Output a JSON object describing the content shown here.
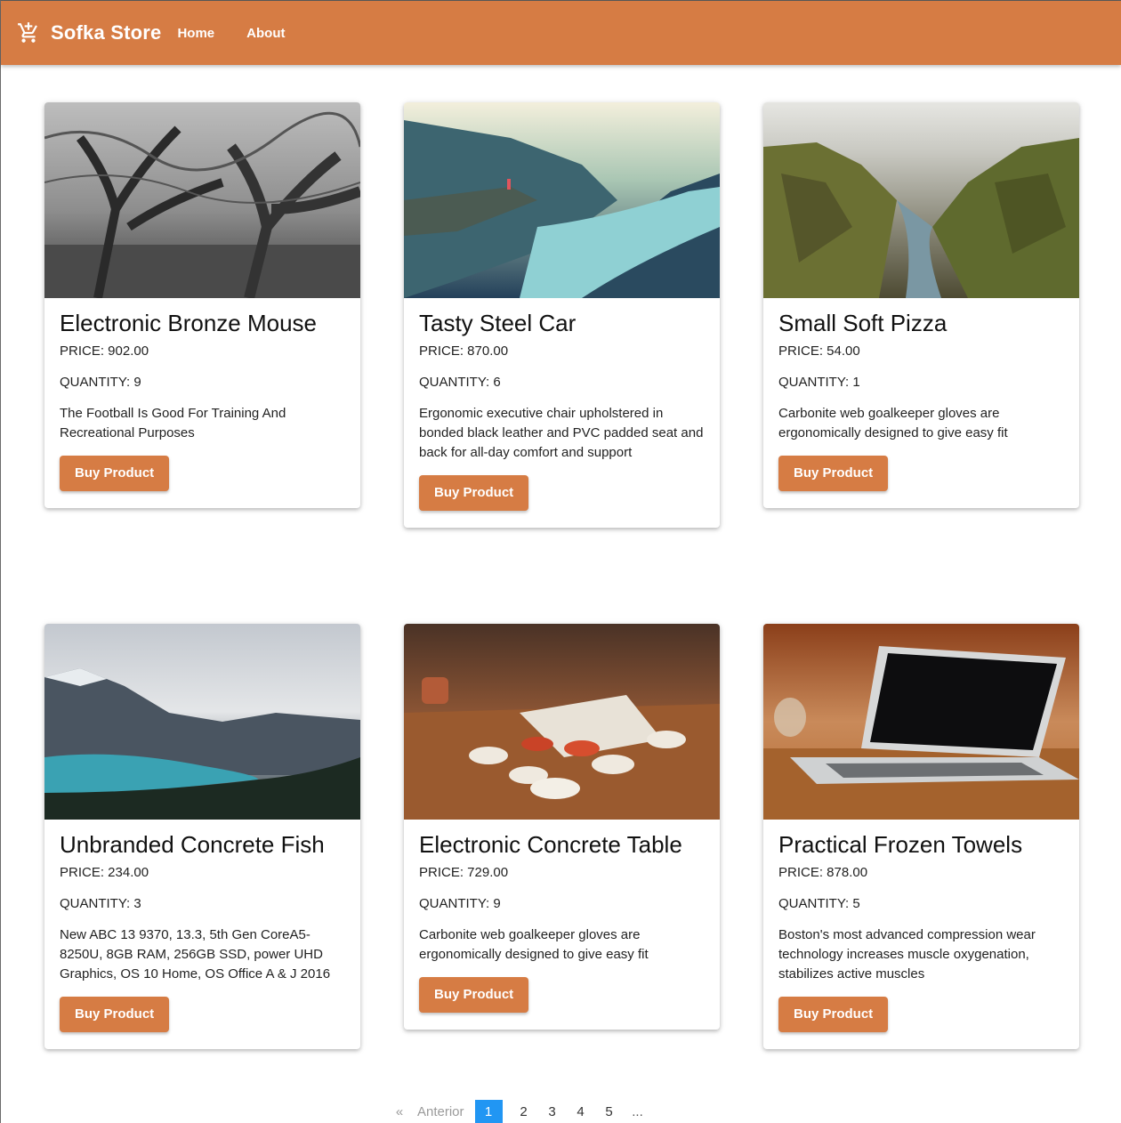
{
  "header": {
    "brand": "Sofka Store",
    "brand_icon": "cart-icon",
    "nav": [
      {
        "label": "Home"
      },
      {
        "label": "About"
      }
    ],
    "color": "#d67c44"
  },
  "products": [
    {
      "title": "Electronic Bronze Mouse",
      "price": "PRICE: 902.00",
      "quantity": "QUANTITY: 9",
      "description": "The Football Is Good For Training And Recreational Purposes",
      "button": "Buy Product",
      "image": "foggy-forest-trees-image"
    },
    {
      "title": "Tasty Steel Car",
      "price": "PRICE: 870.00",
      "quantity": "QUANTITY: 6",
      "description": "Ergonomic executive chair upholstered in bonded black leather and PVC padded seat and back for all-day comfort and support",
      "button": "Buy Product",
      "image": "fjord-cliff-image"
    },
    {
      "title": "Small Soft Pizza",
      "price": "PRICE: 54.00",
      "quantity": "QUANTITY: 1",
      "description": "Carbonite web goalkeeper gloves are ergonomically designed to give easy fit",
      "button": "Buy Product",
      "image": "mossy-canyon-image"
    },
    {
      "title": "Unbranded Concrete Fish",
      "price": "PRICE: 234.00",
      "quantity": "QUANTITY: 3",
      "description": "New ABC 13 9370, 13.3, 5th Gen CoreA5-8250U, 8GB RAM, 256GB SSD, power UHD Graphics, OS 10 Home, OS Office A & J 2016",
      "button": "Buy Product",
      "image": "mountain-lake-image"
    },
    {
      "title": "Electronic Concrete Table",
      "price": "PRICE: 729.00",
      "quantity": "QUANTITY: 9",
      "description": "Carbonite web goalkeeper gloves are ergonomically designed to give easy fit",
      "button": "Buy Product",
      "image": "cups-on-table-image"
    },
    {
      "title": "Practical Frozen Towels",
      "price": "PRICE: 878.00",
      "quantity": "QUANTITY: 5",
      "description": "Boston's most advanced compression wear technology increases muscle oxygenation, stabilizes active muscles",
      "button": "Buy Product",
      "image": "laptop-on-desk-image"
    }
  ],
  "pagination": {
    "prev_symbol": "«",
    "prev_label": "Anterior",
    "pages": [
      "1",
      "2",
      "3",
      "4",
      "5"
    ],
    "active": "1",
    "ellipsis": "...",
    "active_color": "#2196f3"
  }
}
